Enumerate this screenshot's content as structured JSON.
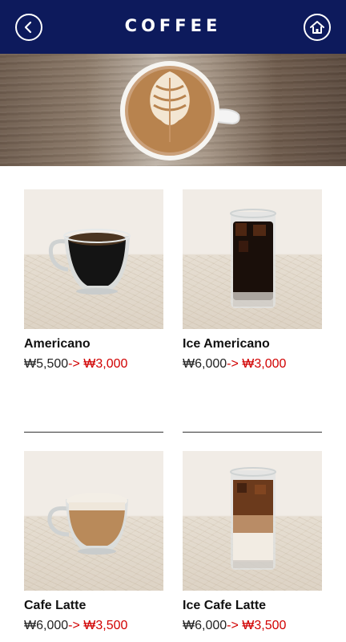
{
  "header": {
    "title": "COFFEE",
    "back_icon": "chevron-left-icon",
    "home_icon": "home-icon",
    "background_color": "#0d1a5c"
  },
  "products": [
    {
      "name": "Americano",
      "original_price": "₩5,500",
      "arrow": "->",
      "sale_price": "₩3,000"
    },
    {
      "name": "Ice Americano",
      "original_price": "₩6,000",
      "arrow": "->",
      "sale_price": "₩3,000"
    },
    {
      "name": "Cafe Latte",
      "original_price": "₩6,000",
      "arrow": "->",
      "sale_price": "₩3,500"
    },
    {
      "name": "Ice Cafe Latte",
      "original_price": "₩6,000",
      "arrow": "->",
      "sale_price": "₩3,500"
    }
  ],
  "colors": {
    "sale_price": "#d10000",
    "accent": "#0d1a5c"
  }
}
